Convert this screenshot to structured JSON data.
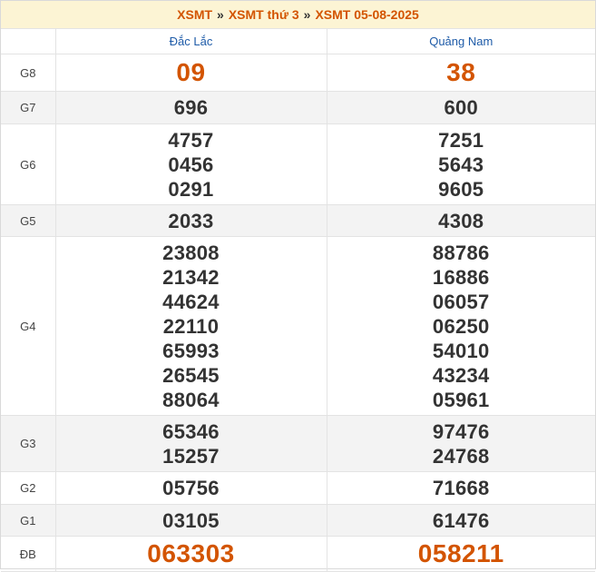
{
  "breadcrumb": {
    "items": [
      "XSMT",
      "XSMT thứ 3",
      "XSMT 05-08-2025"
    ],
    "separator": "»"
  },
  "provinces": [
    "Đắc Lắc",
    "Quảng Nam"
  ],
  "prizes": [
    {
      "label": "G8",
      "values": [
        [
          "09"
        ],
        [
          "38"
        ]
      ]
    },
    {
      "label": "G7",
      "values": [
        [
          "696"
        ],
        [
          "600"
        ]
      ]
    },
    {
      "label": "G6",
      "values": [
        [
          "4757",
          "0456",
          "0291"
        ],
        [
          "7251",
          "5643",
          "9605"
        ]
      ]
    },
    {
      "label": "G5",
      "values": [
        [
          "2033"
        ],
        [
          "4308"
        ]
      ]
    },
    {
      "label": "G4",
      "values": [
        [
          "23808",
          "21342",
          "44624",
          "22110",
          "65993",
          "26545",
          "88064"
        ],
        [
          "88786",
          "16886",
          "06057",
          "06250",
          "54010",
          "43234",
          "05961"
        ]
      ]
    },
    {
      "label": "G3",
      "values": [
        [
          "65346",
          "15257"
        ],
        [
          "97476",
          "24768"
        ]
      ]
    },
    {
      "label": "G2",
      "values": [
        [
          "05756"
        ],
        [
          "71668"
        ]
      ]
    },
    {
      "label": "G1",
      "values": [
        [
          "03105"
        ],
        [
          "61476"
        ]
      ]
    },
    {
      "label": "ĐB",
      "values": [
        [
          "063303"
        ],
        [
          "058211"
        ]
      ]
    }
  ],
  "colors": {
    "accent": "#d35400",
    "header_bg": "#fcf4d4",
    "province_link": "#1e5ba8",
    "number_text": "#333333",
    "shaded_row": "#f3f3f3"
  }
}
